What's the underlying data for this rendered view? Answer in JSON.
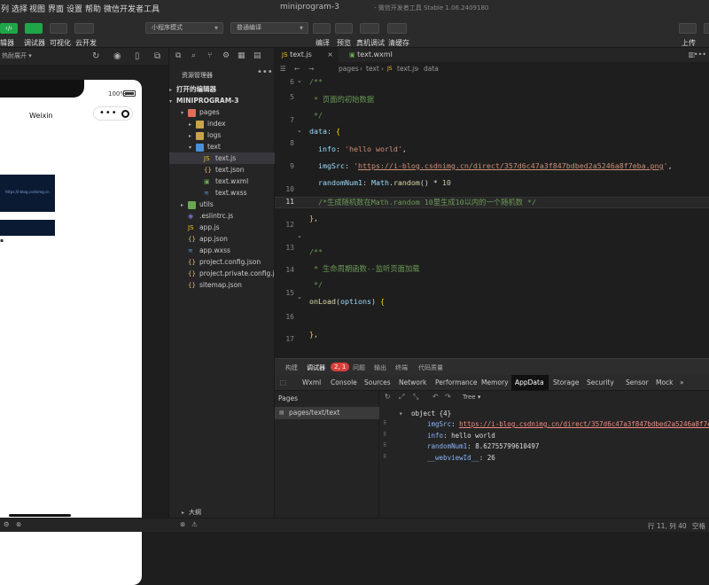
{
  "menubar": {
    "items": [
      "列",
      "选择",
      "视图",
      "界面",
      "设置",
      "帮助",
      "微信开发者工具"
    ],
    "title": "miniprogram-3",
    "subtitle": "- 微信开发者工具 Stable 1.06.2409180"
  },
  "toolbar": {
    "left_labels": [
      "辑器",
      "调试器",
      "可视化",
      "云开发"
    ],
    "green_btn_glyph": "‹/›",
    "mode_select": "小程序模式",
    "compile_select": "普通编译",
    "right_labels": [
      "编译",
      "预览",
      "真机调试",
      "清缓存"
    ],
    "upload_label": "上传"
  },
  "simulator": {
    "device_label": "热耐展开 ▾",
    "battery_text": "100%",
    "nav_title": "Weixin",
    "more_glyph": "•••",
    "image_caption": "https://i-blog.csdnimg.cn/direct/357d6c47a3f847bdbed2a5246a8f7eba.png"
  },
  "filetree": {
    "title": "资源管理器",
    "open_editors": "打开的编辑器",
    "project": "MINIPROGRAM-3",
    "rows": [
      {
        "label": "pages",
        "indent": 1,
        "kind": "folder-pages",
        "caret": "▾"
      },
      {
        "label": "index",
        "indent": 2,
        "kind": "folder",
        "caret": "▸"
      },
      {
        "label": "logs",
        "indent": 2,
        "kind": "folder",
        "caret": "▸"
      },
      {
        "label": "text",
        "indent": 2,
        "kind": "folder-blue",
        "caret": "▾"
      },
      {
        "label": "text.js",
        "indent": 3,
        "kind": "js",
        "caret": "",
        "selected": true
      },
      {
        "label": "text.json",
        "indent": 3,
        "kind": "json",
        "caret": ""
      },
      {
        "label": "text.wxml",
        "indent": 3,
        "kind": "wxml",
        "caret": ""
      },
      {
        "label": "text.wxss",
        "indent": 3,
        "kind": "wxss",
        "caret": ""
      },
      {
        "label": "utils",
        "indent": 1,
        "kind": "folder-utils",
        "caret": "▸"
      },
      {
        "label": ".eslintrc.js",
        "indent": 1,
        "kind": "eslint",
        "caret": ""
      },
      {
        "label": "app.js",
        "indent": 1,
        "kind": "js",
        "caret": ""
      },
      {
        "label": "app.json",
        "indent": 1,
        "kind": "json",
        "caret": ""
      },
      {
        "label": "app.wxss",
        "indent": 1,
        "kind": "wxss",
        "caret": ""
      },
      {
        "label": "project.config.json",
        "indent": 1,
        "kind": "json",
        "caret": ""
      },
      {
        "label": "project.private.config.js...",
        "indent": 1,
        "kind": "json",
        "caret": ""
      },
      {
        "label": "sitemap.json",
        "indent": 1,
        "kind": "json",
        "caret": ""
      }
    ],
    "outline": "大纲"
  },
  "editor": {
    "tabs": [
      "text.js",
      "text.wxml"
    ],
    "breadcrumb": [
      "pages",
      "text",
      "text.js",
      "data"
    ],
    "line_numbers": [
      "6",
      "5",
      "6",
      "7",
      "8",
      "9",
      "10",
      "11",
      "12",
      "13",
      "14",
      "15",
      "16",
      "17",
      "18",
      "19"
    ],
    "current_line": "11"
  },
  "debugger": {
    "top_tabs": [
      "构建",
      "调试器",
      "问题",
      "输出",
      "终端",
      "代码质量"
    ],
    "badge": "2, 1",
    "panel_tabs": [
      "Wxml",
      "Console",
      "Sources",
      "Network",
      "Performance",
      "Memory",
      "AppData",
      "Storage",
      "Security",
      "Sensor",
      "Mock",
      "»"
    ],
    "pages_header": "Pages",
    "page_item": "pages/text/text",
    "tree_select": "Tree",
    "object_label": "object {4}",
    "entries": [
      {
        "key": "imgSrc",
        "value": "https://i-blog.csdnimg.cn/direct/357d6c47a3f847bdbed2a5246a8f7eba",
        "link": true
      },
      {
        "key": "info",
        "value": "hello world",
        "link": false
      },
      {
        "key": "randomNum1",
        "value": "8.62755799610497",
        "link": false
      },
      {
        "key": "__webviewId__",
        "value": "26",
        "link": false
      }
    ]
  },
  "status": {
    "position": "行 11, 列 40",
    "encoding": "空格"
  }
}
